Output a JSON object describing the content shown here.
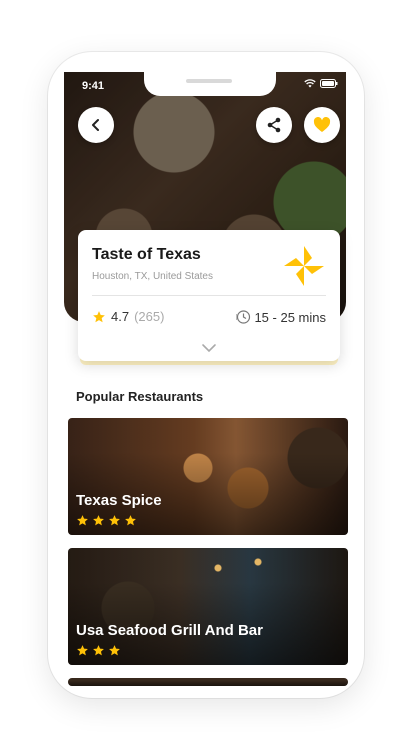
{
  "status_bar": {
    "time": "9:41"
  },
  "restaurant": {
    "name": "Taste of Texas",
    "location": "Houston, TX, United States",
    "rating": "4.7",
    "rating_count": "(265)",
    "delivery_time": "15 - 25 mins"
  },
  "section": {
    "title": "Popular Restaurants"
  },
  "popular": [
    {
      "name": "Texas Spice",
      "stars": 4
    },
    {
      "name": "Usa Seafood Grill And Bar",
      "stars": 3
    }
  ],
  "colors": {
    "accent": "#FFC107",
    "star": "#FFC107",
    "text_dark": "#1a1a1a",
    "muted": "#9a9a9a"
  },
  "icons": {
    "back": "chevron-left-icon",
    "share": "share-icon",
    "favorite": "heart-icon",
    "logo": "pinwheel-logo-icon",
    "rating": "star-icon",
    "time": "clock-icon",
    "expand": "chevron-down-icon"
  }
}
